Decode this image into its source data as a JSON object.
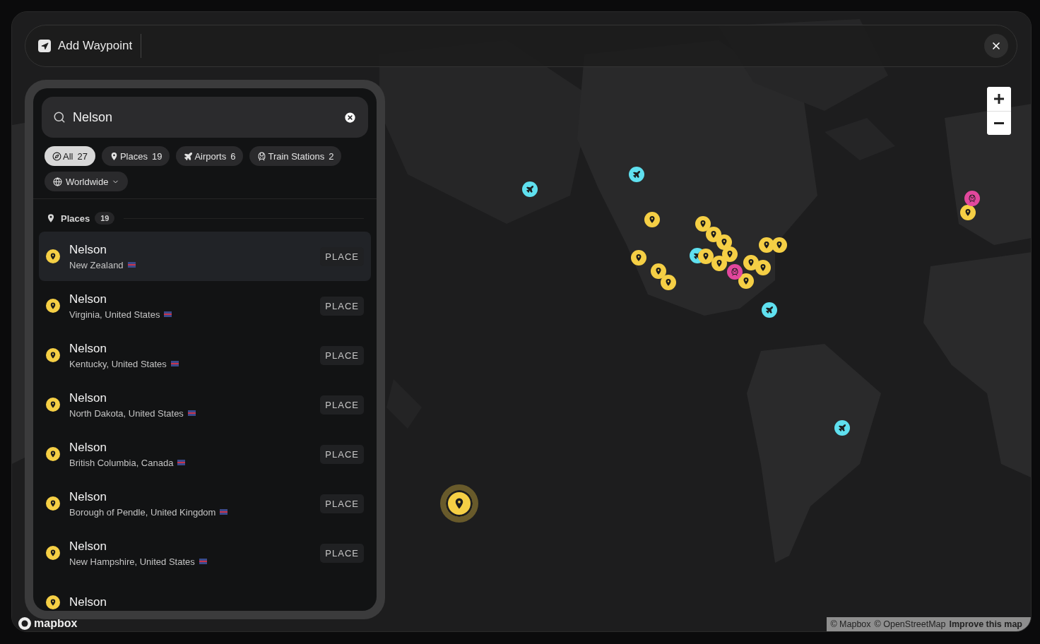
{
  "header": {
    "title": "Add Waypoint"
  },
  "search": {
    "value": "Nelson"
  },
  "filters": [
    {
      "kind": "all",
      "label": "All",
      "count": "27",
      "selected": true
    },
    {
      "kind": "place",
      "label": "Places",
      "count": "19",
      "selected": false
    },
    {
      "kind": "airport",
      "label": "Airports",
      "count": "6",
      "selected": false
    },
    {
      "kind": "train",
      "label": "Train Stations",
      "count": "2",
      "selected": false
    }
  ],
  "scope": {
    "label": "Worldwide"
  },
  "section": {
    "title": "Places",
    "count": "19"
  },
  "results": [
    {
      "name": "Nelson",
      "region": "New Zealand",
      "tag": "PLACE",
      "selected": true
    },
    {
      "name": "Nelson",
      "region": "Virginia, United States",
      "tag": "PLACE",
      "selected": false
    },
    {
      "name": "Nelson",
      "region": "Kentucky, United States",
      "tag": "PLACE",
      "selected": false
    },
    {
      "name": "Nelson",
      "region": "North Dakota, United States",
      "tag": "PLACE",
      "selected": false
    },
    {
      "name": "Nelson",
      "region": "British Columbia, Canada",
      "tag": "PLACE",
      "selected": false
    },
    {
      "name": "Nelson",
      "region": "Borough of Pendle, United Kingdom",
      "tag": "PLACE",
      "selected": false
    },
    {
      "name": "Nelson",
      "region": "New Hampshire, United States",
      "tag": "PLACE",
      "selected": false
    },
    {
      "name": "Nelson",
      "selected": false
    }
  ],
  "markers": [
    {
      "kind": "airport",
      "selected": false
    },
    {
      "kind": "airport",
      "selected": false
    },
    {
      "kind": "airport",
      "selected": false
    },
    {
      "kind": "airport",
      "selected": false
    },
    {
      "kind": "airport",
      "selected": false
    },
    {
      "kind": "place",
      "selected": false
    },
    {
      "kind": "place",
      "selected": false
    },
    {
      "kind": "place",
      "selected": false
    },
    {
      "kind": "place",
      "selected": false
    },
    {
      "kind": "place",
      "selected": false
    },
    {
      "kind": "place",
      "selected": false
    },
    {
      "kind": "place",
      "selected": false
    },
    {
      "kind": "place",
      "selected": false
    },
    {
      "kind": "place",
      "selected": false
    },
    {
      "kind": "place",
      "selected": false
    },
    {
      "kind": "place",
      "selected": false
    },
    {
      "kind": "place",
      "selected": false
    },
    {
      "kind": "place",
      "selected": false
    },
    {
      "kind": "place",
      "selected": false
    },
    {
      "kind": "place",
      "selected": false
    },
    {
      "kind": "place",
      "selected": false
    },
    {
      "kind": "train",
      "selected": false
    },
    {
      "kind": "train",
      "selected": false
    },
    {
      "kind": "place",
      "selected": true
    }
  ],
  "map_logo": "mapbox",
  "attribution": {
    "links": [
      "© Mapbox",
      "© OpenStreetMap"
    ],
    "improve": "Improve this map"
  }
}
